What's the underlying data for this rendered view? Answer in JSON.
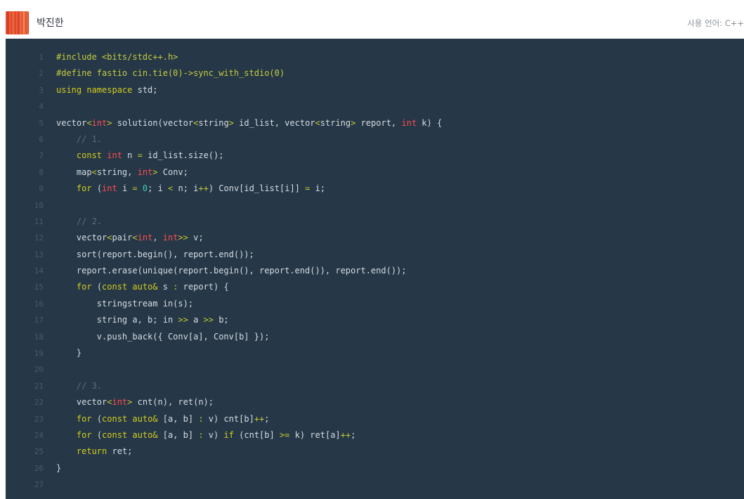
{
  "header": {
    "username": "박진한",
    "language_label": "사용 언어: C++"
  },
  "colors": {
    "code_background": "#263747",
    "line_number": "#4b5a68",
    "plain": "#d6dde3",
    "keyword": "#d4ce1d",
    "type": "#ff4c4c",
    "operator": "#c4c832",
    "number": "#40c9b8",
    "comment": "#5f6e7c"
  },
  "code": {
    "lines": [
      {
        "n": "1",
        "tokens": [
          [
            "pp",
            "#include <bits/stdc++.h>"
          ]
        ]
      },
      {
        "n": "2",
        "tokens": [
          [
            "pp",
            "#define fastio cin.tie(0)->sync_with_stdio(0)"
          ]
        ]
      },
      {
        "n": "3",
        "tokens": [
          [
            "kw",
            "using namespace"
          ],
          [
            "plain",
            " std;"
          ]
        ]
      },
      {
        "n": "4",
        "tokens": []
      },
      {
        "n": "5",
        "tokens": [
          [
            "plain",
            "vector"
          ],
          [
            "op",
            "<"
          ],
          [
            "ty",
            "int"
          ],
          [
            "op",
            ">"
          ],
          [
            "plain",
            " solution(vector"
          ],
          [
            "op",
            "<"
          ],
          [
            "plain",
            "string"
          ],
          [
            "op",
            ">"
          ],
          [
            "plain",
            " id_list, vector"
          ],
          [
            "op",
            "<"
          ],
          [
            "plain",
            "string"
          ],
          [
            "op",
            ">"
          ],
          [
            "plain",
            " report, "
          ],
          [
            "ty",
            "int"
          ],
          [
            "plain",
            " k) {"
          ]
        ]
      },
      {
        "n": "6",
        "tokens": [
          [
            "plain",
            "    "
          ],
          [
            "cm",
            "// 1."
          ]
        ]
      },
      {
        "n": "7",
        "tokens": [
          [
            "plain",
            "    "
          ],
          [
            "kw",
            "const"
          ],
          [
            "plain",
            " "
          ],
          [
            "ty",
            "int"
          ],
          [
            "plain",
            " n "
          ],
          [
            "op",
            "="
          ],
          [
            "plain",
            " id_list.size();"
          ]
        ]
      },
      {
        "n": "8",
        "tokens": [
          [
            "plain",
            "    map"
          ],
          [
            "op",
            "<"
          ],
          [
            "plain",
            "string, "
          ],
          [
            "ty",
            "int"
          ],
          [
            "op",
            ">"
          ],
          [
            "plain",
            " Conv;"
          ]
        ]
      },
      {
        "n": "9",
        "tokens": [
          [
            "plain",
            "    "
          ],
          [
            "kw",
            "for"
          ],
          [
            "plain",
            " ("
          ],
          [
            "ty",
            "int"
          ],
          [
            "plain",
            " i "
          ],
          [
            "op",
            "="
          ],
          [
            "plain",
            " "
          ],
          [
            "num",
            "0"
          ],
          [
            "plain",
            "; i "
          ],
          [
            "op",
            "<"
          ],
          [
            "plain",
            " n; i"
          ],
          [
            "op",
            "++"
          ],
          [
            "plain",
            ") Conv[id_list[i]] "
          ],
          [
            "op",
            "="
          ],
          [
            "plain",
            " i;"
          ]
        ]
      },
      {
        "n": "10",
        "tokens": []
      },
      {
        "n": "11",
        "tokens": [
          [
            "plain",
            "    "
          ],
          [
            "cm",
            "// 2."
          ]
        ]
      },
      {
        "n": "12",
        "tokens": [
          [
            "plain",
            "    vector"
          ],
          [
            "op",
            "<"
          ],
          [
            "plain",
            "pair"
          ],
          [
            "op",
            "<"
          ],
          [
            "ty",
            "int"
          ],
          [
            "plain",
            ", "
          ],
          [
            "ty",
            "int"
          ],
          [
            "op",
            ">>"
          ],
          [
            "plain",
            " v;"
          ]
        ]
      },
      {
        "n": "13",
        "tokens": [
          [
            "plain",
            "    sort(report.begin(), report.end());"
          ]
        ]
      },
      {
        "n": "14",
        "tokens": [
          [
            "plain",
            "    report.erase(unique(report.begin(), report.end()), report.end());"
          ]
        ]
      },
      {
        "n": "15",
        "tokens": [
          [
            "plain",
            "    "
          ],
          [
            "kw",
            "for"
          ],
          [
            "plain",
            " ("
          ],
          [
            "kw",
            "const auto&"
          ],
          [
            "plain",
            " s "
          ],
          [
            "op",
            ":"
          ],
          [
            "plain",
            " report) {"
          ]
        ]
      },
      {
        "n": "16",
        "tokens": [
          [
            "plain",
            "        stringstream in(s);"
          ]
        ]
      },
      {
        "n": "17",
        "tokens": [
          [
            "plain",
            "        string a, b; in "
          ],
          [
            "op",
            ">>"
          ],
          [
            "plain",
            " a "
          ],
          [
            "op",
            ">>"
          ],
          [
            "plain",
            " b;"
          ]
        ]
      },
      {
        "n": "18",
        "tokens": [
          [
            "plain",
            "        v.push_back({ Conv[a], Conv[b] });"
          ]
        ]
      },
      {
        "n": "19",
        "tokens": [
          [
            "plain",
            "    }"
          ]
        ]
      },
      {
        "n": "20",
        "tokens": []
      },
      {
        "n": "21",
        "tokens": [
          [
            "plain",
            "    "
          ],
          [
            "cm",
            "// 3."
          ]
        ]
      },
      {
        "n": "22",
        "tokens": [
          [
            "plain",
            "    vector"
          ],
          [
            "op",
            "<"
          ],
          [
            "ty",
            "int"
          ],
          [
            "op",
            ">"
          ],
          [
            "plain",
            " cnt(n), ret(n);"
          ]
        ]
      },
      {
        "n": "23",
        "tokens": [
          [
            "plain",
            "    "
          ],
          [
            "kw",
            "for"
          ],
          [
            "plain",
            " ("
          ],
          [
            "kw",
            "const auto&"
          ],
          [
            "plain",
            " [a, b] "
          ],
          [
            "op",
            ":"
          ],
          [
            "plain",
            " v) cnt[b]"
          ],
          [
            "op",
            "++"
          ],
          [
            "plain",
            ";"
          ]
        ]
      },
      {
        "n": "24",
        "tokens": [
          [
            "plain",
            "    "
          ],
          [
            "kw",
            "for"
          ],
          [
            "plain",
            " ("
          ],
          [
            "kw",
            "const auto&"
          ],
          [
            "plain",
            " [a, b] "
          ],
          [
            "op",
            ":"
          ],
          [
            "plain",
            " v) "
          ],
          [
            "kw",
            "if"
          ],
          [
            "plain",
            " (cnt[b] "
          ],
          [
            "op",
            ">="
          ],
          [
            "plain",
            " k) ret[a]"
          ],
          [
            "op",
            "++"
          ],
          [
            "plain",
            ";"
          ]
        ]
      },
      {
        "n": "25",
        "tokens": [
          [
            "plain",
            "    "
          ],
          [
            "kw",
            "return"
          ],
          [
            "plain",
            " ret;"
          ]
        ]
      },
      {
        "n": "26",
        "tokens": [
          [
            "plain",
            "}"
          ]
        ]
      },
      {
        "n": "27",
        "tokens": []
      }
    ]
  }
}
